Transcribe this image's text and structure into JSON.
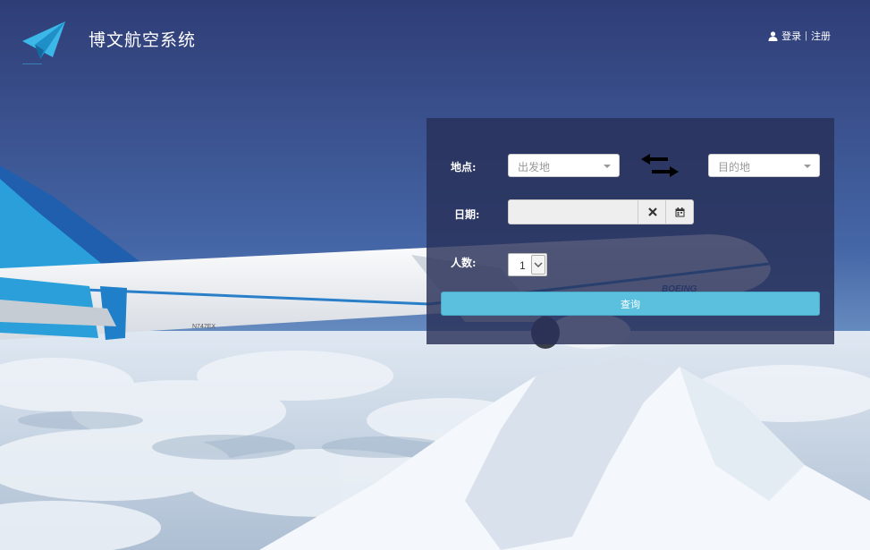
{
  "header": {
    "app_title": "博文航空系统",
    "logo_icon": "paper-plane-icon",
    "user_icon": "user-icon",
    "login_label": "登录",
    "separator": "|",
    "register_label": "注册"
  },
  "search_form": {
    "location_label": "地点:",
    "origin_placeholder": "出发地",
    "destination_placeholder": "目的地",
    "swap_icon": "swap-arrows-icon",
    "date_label": "日期:",
    "date_value": "",
    "clear_icon": "close-icon",
    "calendar_icon": "calendar-icon",
    "passengers_label": "人数:",
    "passengers_value": "1",
    "query_button": "查询"
  },
  "colors": {
    "panel_bg": "#283058",
    "button_bg": "#5bc0de",
    "sky_top": "#2f3d76",
    "sky_bottom": "#6f9ad0"
  }
}
